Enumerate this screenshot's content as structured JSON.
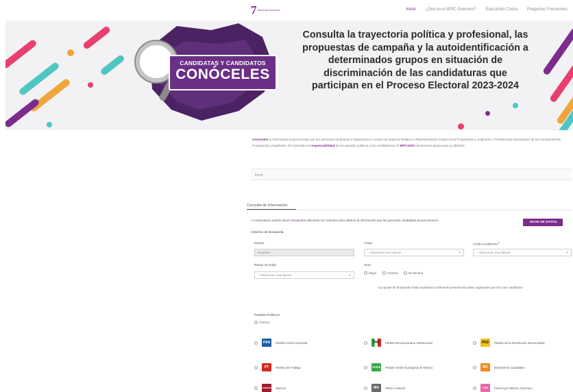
{
  "header": {
    "logo_number": "7",
    "logo_sub": "Electoral Guerrero",
    "nav": [
      "Inicio",
      "¿Qué es el IEPC Guerrero?",
      "Educación Cívica",
      "Preguntas Frecuentes"
    ]
  },
  "banner": {
    "brand_top": "CANDIDATAS Y CANDIDATOS",
    "brand_main": "CONÓCELES",
    "headline": "Consulta la trayectoria política y profesional, las propuestas de campaña y la autoidentificación a determinados grupos en situación de discriminación de las candidaturas que participan en el Proceso Electoral 2023-2024"
  },
  "notice": {
    "lead": "Conóceles",
    "text1": " la información proporcionada por las personas candidatas a Diputaciones Locales de Mayoría Relativa y Representación Proporcional Propietarias y Suplentes y Presidencias Municipales de los Ayuntamientos Propietarias y Suplentes. El contenido es ",
    "resp": "responsabilidad",
    "text2": " de los partidos políticos y las candidaturas. El ",
    "org": "IEPCGRO",
    "text3": " únicamente apoya para su difusión."
  },
  "breadcrumb": "Inicio",
  "tab_label": "Consulta de Información",
  "intro": {
    "text1": "A continuación podrás hacer ",
    "link": "búsquedas",
    "text2": " utilizando los controles para obtener la información que las personas candidatas proporcionaron."
  },
  "db_button": "BASE DE DATOS",
  "criteria_title": "Criterios de Búsqueda",
  "fields": {
    "estado_label": "Estado",
    "estado_value": "Guerrero",
    "cargo_label": "Cargo",
    "cargo_value": "-- Seleccione una Opción",
    "grado_label": "Grado Académico",
    "grado_sup": "1",
    "grado_value": "-- Seleccione una Opción",
    "edad_label": "Rango de Edad",
    "edad_value": "-- Seleccione una Opción",
    "sexo_label": "Sexo",
    "sexo_options": [
      "Mujer",
      "Hombre",
      "No Binario"
    ]
  },
  "note": "¹La opción de búsqueda Grado académico solamente presenta los datos capturados por las y los candidatos",
  "parties_title": "Partidos Políticos",
  "todos_label": "TODOS",
  "parties": [
    {
      "name": "Partido Acción Nacional",
      "color": "#1a5da8",
      "icon": "pan-logo-icon",
      "abbr": "PAN"
    },
    {
      "name": "Partido Revolucionario Institucional",
      "color": "#2b9a3a",
      "icon": "pri-logo-icon",
      "abbr": "PRI"
    },
    {
      "name": "Partido de la Revolución Democrática",
      "color": "#f2c018",
      "icon": "prd-logo-icon",
      "abbr": "PRD"
    },
    {
      "name": "Partido del Trabajo",
      "color": "#d8281f",
      "icon": "pt-logo-icon",
      "abbr": "PT"
    },
    {
      "name": "Partido Verde Ecologista de México",
      "color": "#3aa84a",
      "icon": "pvem-logo-icon",
      "abbr": "VERDE"
    },
    {
      "name": "Movimiento Ciudadano",
      "color": "#f08a1f",
      "icon": "mc-logo-icon",
      "abbr": "MC"
    },
    {
      "name": "Morena",
      "color": "#a01c2c",
      "icon": "morena-logo-icon",
      "abbr": "morena"
    },
    {
      "name": "México Avanza",
      "color": "#6a6a6a",
      "icon": "mexico-avanza-logo-icon",
      "abbr": "MA"
    },
    {
      "name": "Fuerza por México Guerrero",
      "color": "#e86aa8",
      "icon": "fuerza-mexico-logo-icon",
      "abbr": "FxM"
    }
  ],
  "colors": {
    "accent": "#7b2c8c"
  }
}
